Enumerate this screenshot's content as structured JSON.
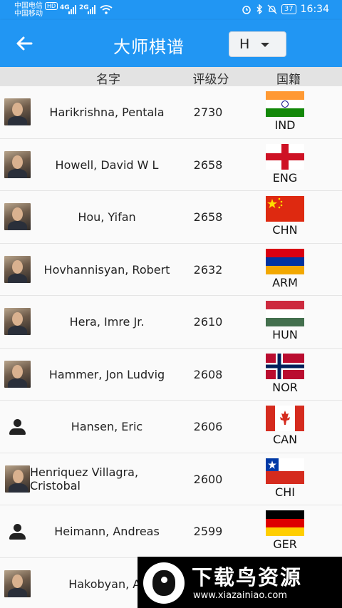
{
  "status_bar": {
    "carrier_1": "中国电信",
    "hd_badge": "HD",
    "carrier_2": "中国移动",
    "net_1": "4G",
    "net_2": "2G",
    "battery": "37",
    "time": "16:34"
  },
  "app_bar": {
    "title": "大师棋谱",
    "letter_filter": "H"
  },
  "columns": {
    "name": "名字",
    "rating": "评级分",
    "country": "国籍"
  },
  "players": [
    {
      "name": "Harikrishna, Pentala",
      "rating": "2730",
      "country": "IND",
      "avatar": "photo"
    },
    {
      "name": "Howell, David W L",
      "rating": "2658",
      "country": "ENG",
      "avatar": "photo"
    },
    {
      "name": "Hou, Yifan",
      "rating": "2658",
      "country": "CHN",
      "avatar": "photo"
    },
    {
      "name": "Hovhannisyan, Robert",
      "rating": "2632",
      "country": "ARM",
      "avatar": "photo"
    },
    {
      "name": "Hera, Imre Jr.",
      "rating": "2610",
      "country": "HUN",
      "avatar": "photo"
    },
    {
      "name": "Hammer, Jon Ludvig",
      "rating": "2608",
      "country": "NOR",
      "avatar": "photo"
    },
    {
      "name": "Hansen, Eric",
      "rating": "2606",
      "country": "CAN",
      "avatar": "person-icon"
    },
    {
      "name": "Henriquez Villagra, Cristobal",
      "rating": "2600",
      "country": "CHI",
      "avatar": "photo"
    },
    {
      "name": "Heimann, Andreas",
      "rating": "2599",
      "country": "GER",
      "avatar": "person-icon"
    },
    {
      "name": "Hakobyan, Ar",
      "rating": "",
      "country": "",
      "avatar": "photo"
    }
  ],
  "watermark": {
    "title": "下载鸟资源",
    "url": "www.xiazainiao.com"
  },
  "colors": {
    "primary": "#2196f3",
    "header_bg": "#e3e3e3"
  }
}
